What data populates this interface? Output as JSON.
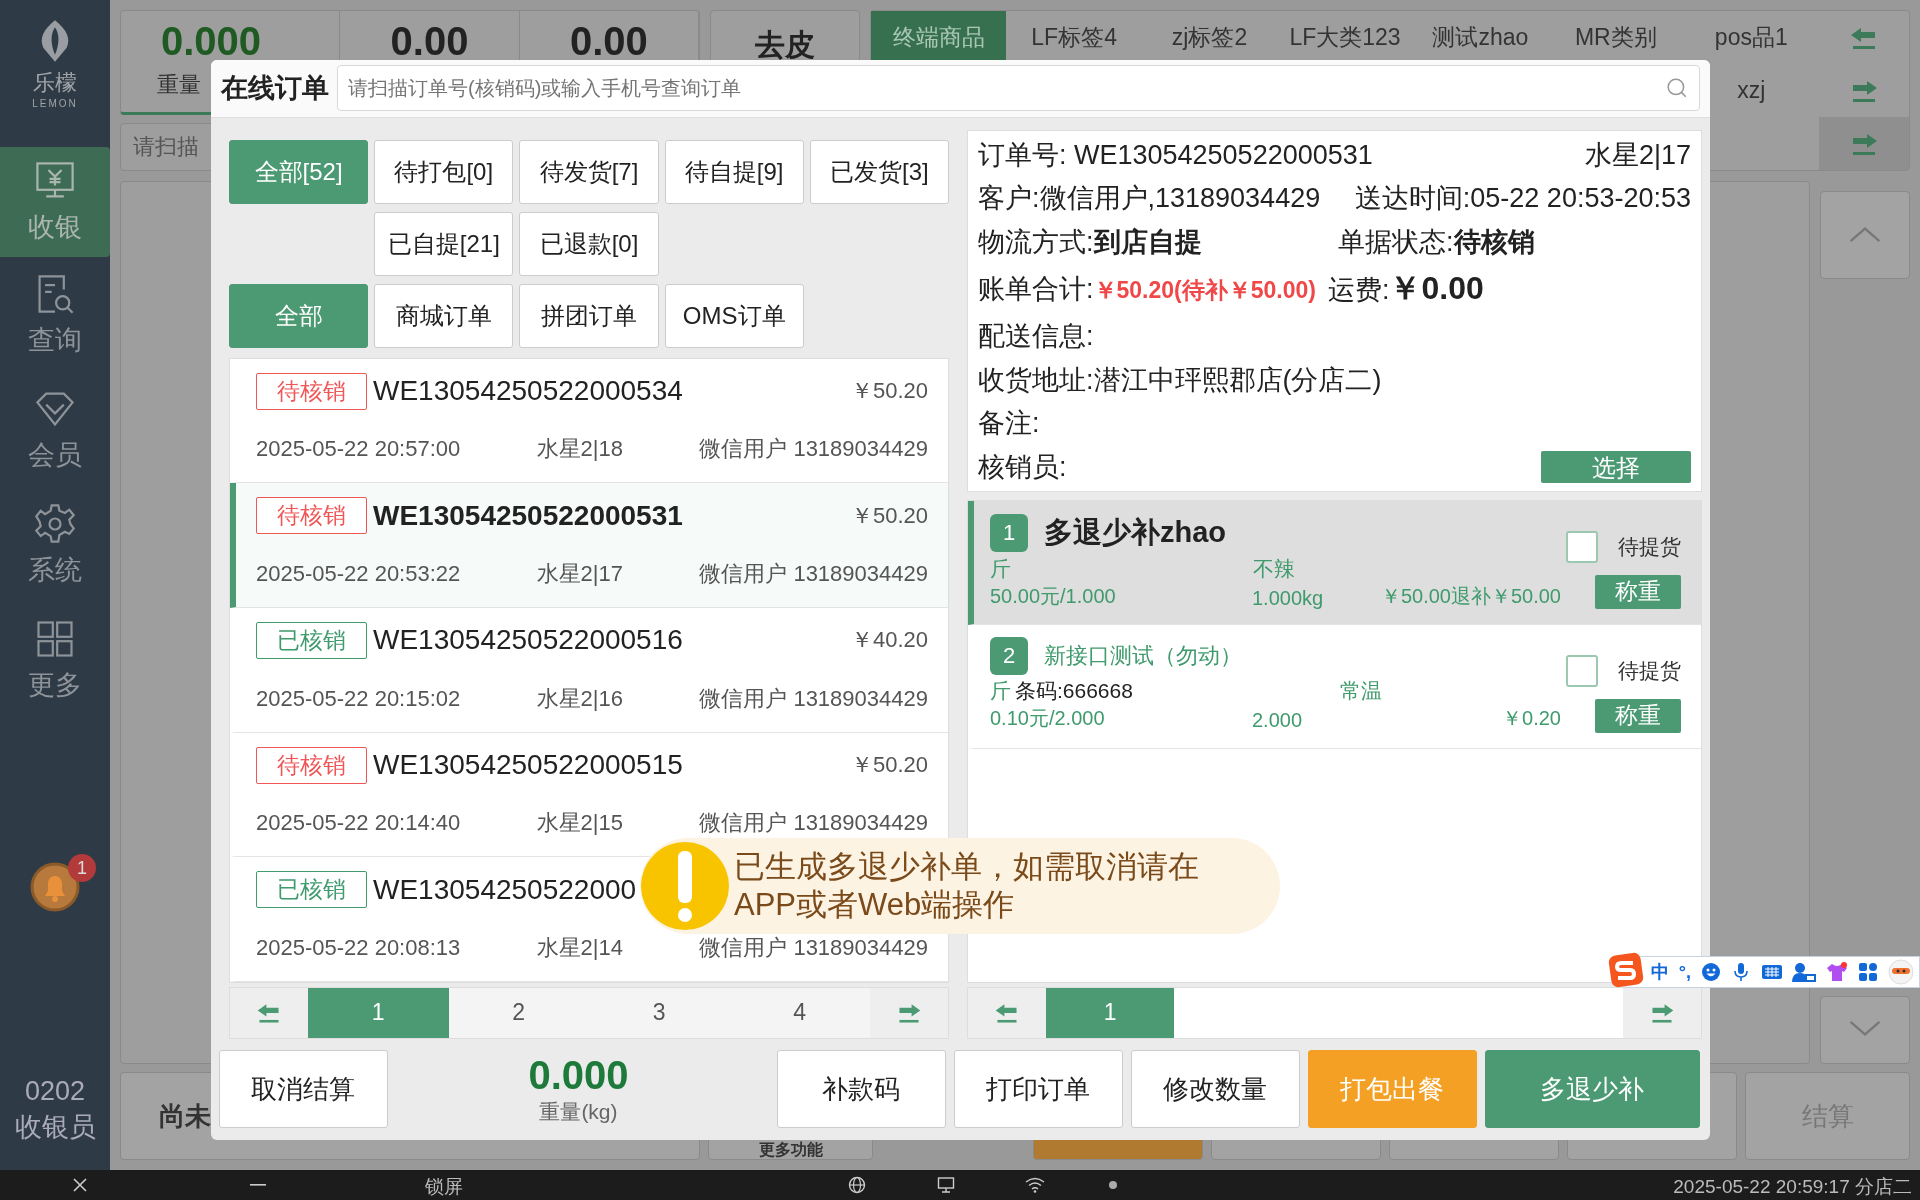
{
  "sidebar": {
    "logo": {
      "name": "乐檬",
      "sub": "LEMON"
    },
    "items": [
      {
        "label": "收银",
        "selected": true
      },
      {
        "label": "查询",
        "selected": false
      },
      {
        "label": "会员",
        "selected": false
      },
      {
        "label": "系统",
        "selected": false
      },
      {
        "label": "更多",
        "selected": false
      }
    ],
    "notifications": {
      "count": "1"
    },
    "user": {
      "code": "0202",
      "role": "收银员"
    }
  },
  "scale": {
    "weight": "0.000",
    "weight_label": "重量",
    "value_2": "0.00",
    "value_3": "0.00"
  },
  "tare_button": "去皮",
  "categories": {
    "row_1": [
      {
        "label": "终端商品",
        "selected": true
      },
      {
        "label": "LF标签4",
        "selected": false
      },
      {
        "label": "zj标签2",
        "selected": false
      },
      {
        "label": "LF大类123",
        "selected": false
      },
      {
        "label": "测试zhao",
        "selected": false
      },
      {
        "label": "MR类别",
        "selected": false
      },
      {
        "label": "pos品1",
        "selected": false
      }
    ],
    "row_2": [
      {
        "label": "xzj",
        "selected": false
      }
    ]
  },
  "barcode_field": {
    "placeholder": "请扫描"
  },
  "bottom_buttons": {
    "pending": "尚未",
    "more": "更多功能",
    "checkout": "结算"
  },
  "modal": {
    "title": "在线订单",
    "search": {
      "placeholder": "请扫描订单号(核销码)或输入手机号查询订单"
    },
    "status_filters": [
      {
        "label": "全部[52]",
        "selected": true
      },
      {
        "label": "待打包[0]",
        "selected": false
      },
      {
        "label": "待发货[7]",
        "selected": false
      },
      {
        "label": "待自提[9]",
        "selected": false
      },
      {
        "label": "已发货[3]",
        "selected": false
      },
      {
        "label": "已自提[21]",
        "selected": false
      },
      {
        "label": "已退款[0]",
        "selected": false
      }
    ],
    "type_filters": [
      {
        "label": "全部",
        "selected": true
      },
      {
        "label": "商城订单",
        "selected": false
      },
      {
        "label": "拼团订单",
        "selected": false
      },
      {
        "label": "OMS订单",
        "selected": false
      }
    ],
    "orders": [
      {
        "status": "待核销",
        "color": "#f05656",
        "number": "WE13054250522000534",
        "amount": "￥50.20",
        "time": "2025-05-22 20:57:00",
        "table": "水星2|18",
        "customer": "微信用户 13189034429",
        "selected": false
      },
      {
        "status": "待核销",
        "color": "#f05656",
        "number": "WE13054250522000531",
        "amount": "￥50.20",
        "time": "2025-05-22 20:53:22",
        "table": "水星2|17",
        "customer": "微信用户 13189034429",
        "selected": true
      },
      {
        "status": "已核销",
        "color": "#3f9a6c",
        "number": "WE13054250522000516",
        "amount": "￥40.20",
        "time": "2025-05-22 20:15:02",
        "table": "水星2|16",
        "customer": "微信用户 13189034429",
        "selected": false
      },
      {
        "status": "待核销",
        "color": "#f05656",
        "number": "WE13054250522000515",
        "amount": "￥50.20",
        "time": "2025-05-22 20:14:40",
        "table": "水星2|15",
        "customer": "微信用户 13189034429",
        "selected": false
      },
      {
        "status": "已核销",
        "color": "#3f9a6c",
        "number": "WE13054250522000",
        "time": "2025-05-22 20:08:13",
        "table": "水星2|14",
        "customer": "微信用户 13189034429",
        "selected": false
      }
    ],
    "orders_pages": [
      {
        "label": "1",
        "selected": true
      },
      {
        "label": "2",
        "selected": false
      },
      {
        "label": "3",
        "selected": false
      },
      {
        "label": "4",
        "selected": false
      }
    ],
    "detail": {
      "order_no": {
        "label": "订单号:",
        "value": "WE13054250522000531"
      },
      "table": "水星2|17",
      "customer": {
        "label": "客户:",
        "value": "微信用户,13189034429"
      },
      "delivery_time": {
        "label": "送达时间:",
        "value": "05-22 20:53-20:53"
      },
      "logistics": {
        "label": "物流方式:",
        "value": "到店自提"
      },
      "status": {
        "label": "单据状态:",
        "value": "待核销"
      },
      "total": {
        "label": "账单合计:",
        "value": "￥50.20(待补￥50.00)"
      },
      "freight": {
        "label": "运费:",
        "value": "￥0.00"
      },
      "delivery_info": {
        "label": "配送信息:"
      },
      "address": {
        "label": "收货地址:",
        "value": "潜江中玶熙郡店(分店二)"
      },
      "note": {
        "label": "备注:"
      },
      "verifier": {
        "label": "核销员:",
        "button": "选择"
      }
    },
    "products": [
      {
        "index": "1",
        "name": "多退少补zhao",
        "unit": "斤",
        "spec": "不辣",
        "price": "50.00元/1.000",
        "qty": "1.000kg",
        "amount": "￥50.00退补￥50.00",
        "status": "待提货",
        "checked": false,
        "button": "称重",
        "selected": true
      },
      {
        "index": "2",
        "name": "新接口测试（勿动）",
        "unit": "斤",
        "barcode": "条码:666668",
        "spec": "常温",
        "price": "0.10元/2.000",
        "qty": "2.000",
        "amount": "￥0.20",
        "status": "待提货",
        "checked": false,
        "button": "称重",
        "selected": false
      }
    ],
    "products_pages": [
      {
        "label": "1",
        "selected": true
      }
    ],
    "cancel_button": "取消结算",
    "weight": {
      "value": "0.000",
      "label": "重量(kg)"
    },
    "actions": [
      {
        "label": "补款码",
        "kind": "plain"
      },
      {
        "label": "打印订单",
        "kind": "plain"
      },
      {
        "label": "修改数量",
        "kind": "plain"
      },
      {
        "label": "打包出餐",
        "kind": "orange"
      },
      {
        "label": "多退少补",
        "kind": "green"
      }
    ]
  },
  "toast": {
    "text": "已生成多退少补单，如需取消请在APP或者Web端操作"
  },
  "ime_bar": {
    "mode": "中",
    "punctuation": "°,"
  },
  "taskbar": {
    "lock": "锁屏",
    "clock": "2025-05-22 20:59:17 分店二"
  }
}
